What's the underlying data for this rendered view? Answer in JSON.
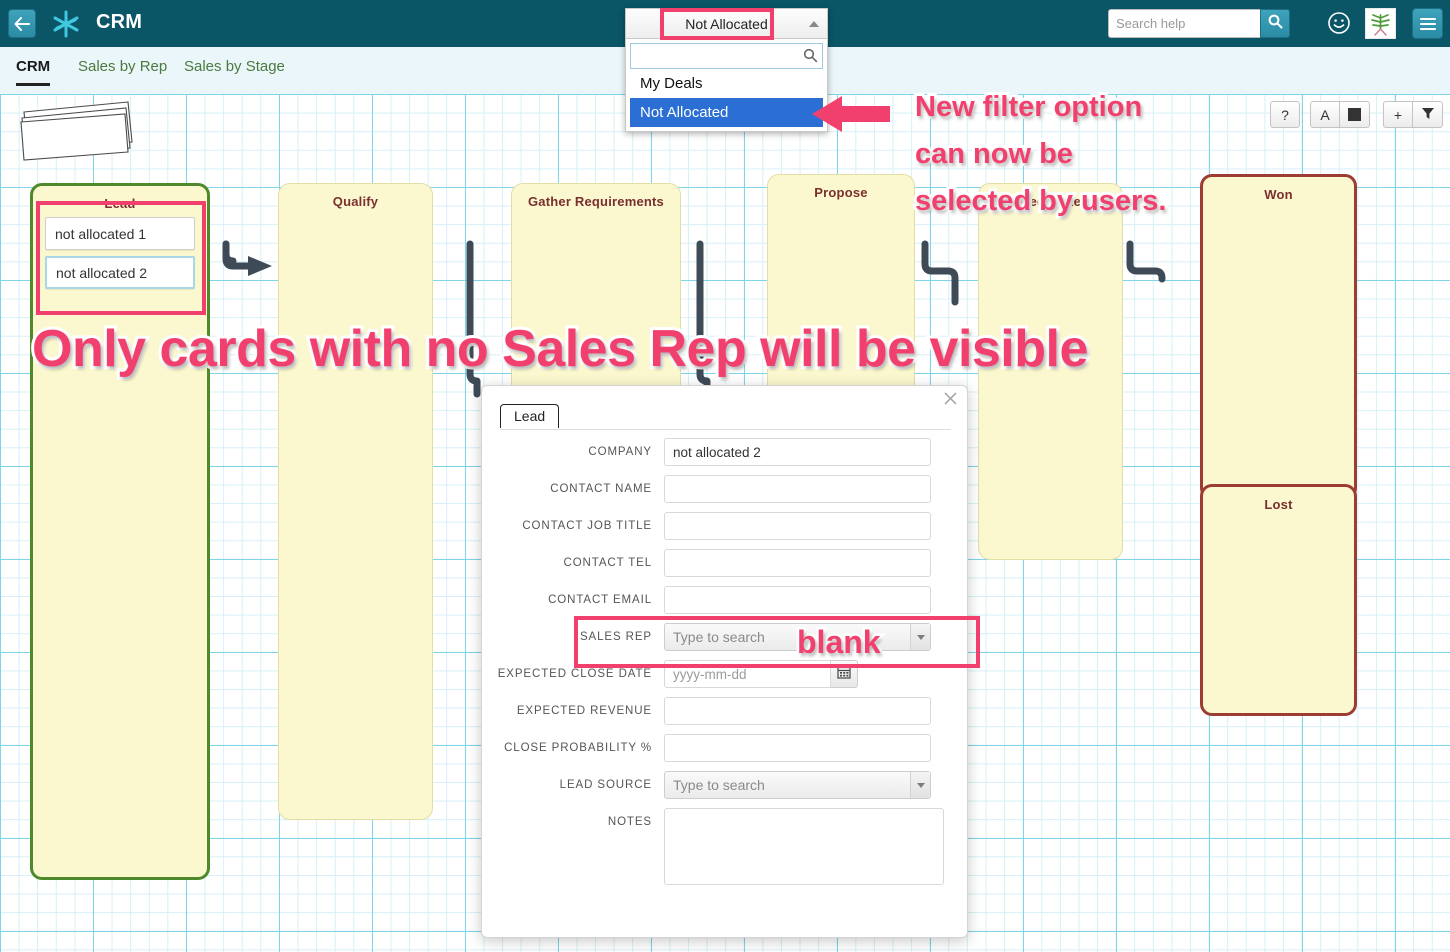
{
  "header": {
    "back_icon": "arrow-left-icon",
    "logo_icon": "asterisk-logo-icon",
    "title": "CRM",
    "help_search_placeholder": "Search help",
    "help_search_value": "",
    "search_icon": "search-icon",
    "smiley_icon": "smiley-icon",
    "avatar_icon": "avatar-icon",
    "menu_icon": "hamburger-menu-icon"
  },
  "tabs": [
    {
      "label": "CRM",
      "active": true
    },
    {
      "label": "Sales by Rep",
      "active": false
    },
    {
      "label": "Sales by Stage",
      "active": false
    }
  ],
  "filter_dropdown": {
    "selected": "Not Allocated",
    "search_placeholder": "",
    "search_value": "",
    "search_icon": "search-icon",
    "caret_icon": "chevron-up-icon",
    "options": [
      {
        "label": "My Deals",
        "highlighted": false
      },
      {
        "label": "Not Allocated",
        "highlighted": true
      }
    ]
  },
  "toolbar": {
    "help_label": "?",
    "text_label": "A",
    "fill_label": "square-icon",
    "add_label": "+",
    "filter_label": "funnel-icon"
  },
  "board": {
    "card_stack_icon": "card-stack-icon",
    "columns": [
      {
        "title": "Lead",
        "cards": [
          {
            "label": "not allocated 1",
            "selected": false
          },
          {
            "label": "not allocated 2",
            "selected": true
          }
        ]
      },
      {
        "title": "Qualify",
        "cards": []
      },
      {
        "title": "Gather Requirements",
        "cards": []
      },
      {
        "title": "Propose",
        "cards": []
      },
      {
        "title": "Negotiate",
        "cards": []
      },
      {
        "title": "Won",
        "cards": []
      },
      {
        "title": "Lost",
        "cards": []
      }
    ]
  },
  "dialog": {
    "tab_label": "Lead",
    "close_icon": "close-icon",
    "calendar_icon": "calendar-icon",
    "fields": [
      {
        "label": "COMPANY",
        "type": "text",
        "value": "not allocated 2",
        "placeholder": ""
      },
      {
        "label": "CONTACT NAME",
        "type": "text",
        "value": "",
        "placeholder": ""
      },
      {
        "label": "CONTACT JOB TITLE",
        "type": "text",
        "value": "",
        "placeholder": ""
      },
      {
        "label": "CONTACT TEL",
        "type": "text",
        "value": "",
        "placeholder": ""
      },
      {
        "label": "CONTACT EMAIL",
        "type": "text",
        "value": "",
        "placeholder": ""
      },
      {
        "label": "SALES REP",
        "type": "select",
        "value": "",
        "placeholder": "Type to search"
      },
      {
        "label": "EXPECTED CLOSE DATE",
        "type": "date",
        "value": "",
        "placeholder": "yyyy-mm-dd"
      },
      {
        "label": "EXPECTED REVENUE",
        "type": "text",
        "value": "",
        "placeholder": ""
      },
      {
        "label": "CLOSE PROBABILITY %",
        "type": "text",
        "value": "",
        "placeholder": ""
      },
      {
        "label": "LEAD SOURCE",
        "type": "select",
        "value": "",
        "placeholder": "Type to search"
      },
      {
        "label": "NOTES",
        "type": "textarea",
        "value": "",
        "placeholder": ""
      }
    ]
  },
  "annotations": {
    "filter_note_line1": "New filter option",
    "filter_note_line2": "can now be",
    "filter_note_line3": "selected by users.",
    "visible_note": "Only cards with no Sales Rep will be visible",
    "blank_note": "blank",
    "accent_color": "#f2406e",
    "highlight_color": "#2b6fd4"
  }
}
